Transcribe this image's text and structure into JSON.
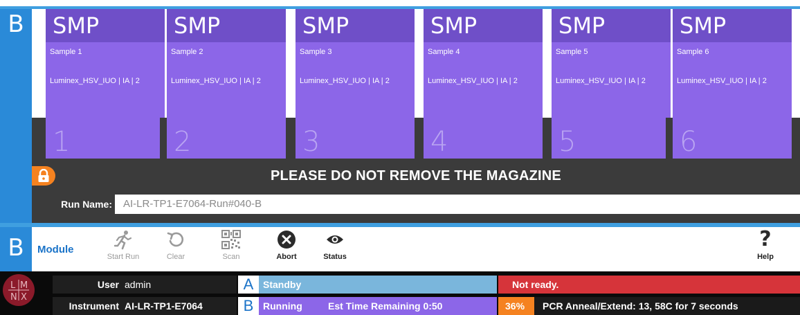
{
  "module": {
    "letter": "B",
    "magazine_message": "PLEASE DO NOT REMOVE THE MAGAZINE",
    "run_name_label": "Run Name:",
    "run_name_value": "AI-LR-TP1-E7064-Run#040-B",
    "samples": [
      {
        "type": "SMP",
        "name": "Sample 1",
        "assay": "Luminex_HSV_IUO | IA | 2",
        "slot": "1"
      },
      {
        "type": "SMP",
        "name": "Sample 2",
        "assay": "Luminex_HSV_IUO | IA | 2",
        "slot": "2"
      },
      {
        "type": "SMP",
        "name": "Sample 3",
        "assay": "Luminex_HSV_IUO | IA | 2",
        "slot": "3"
      },
      {
        "type": "SMP",
        "name": "Sample 4",
        "assay": "Luminex_HSV_IUO | IA | 2",
        "slot": "4"
      },
      {
        "type": "SMP",
        "name": "Sample 5",
        "assay": "Luminex_HSV_IUO | IA | 2",
        "slot": "5"
      },
      {
        "type": "SMP",
        "name": "Sample 6",
        "assay": "Luminex_HSV_IUO | IA | 2",
        "slot": "6"
      }
    ]
  },
  "toolbar": {
    "letter": "B",
    "module_label": "Module",
    "start_run": "Start Run",
    "clear": "Clear",
    "scan": "Scan",
    "abort": "Abort",
    "status": "Status",
    "help": "Help"
  },
  "statusbar": {
    "logo_text": "L|M N|X",
    "user_label": "User",
    "user_value": "admin",
    "instrument_label": "Instrument",
    "instrument_value": "AI-LR-TP1-E7064",
    "module_a": {
      "letter": "A",
      "state": "Standby",
      "message": "Not ready."
    },
    "module_b": {
      "letter": "B",
      "state": "Running",
      "remaining": "Est Time Remaining 0:50",
      "progress_percent": "36%",
      "progress_fraction": 0.36,
      "step": "PCR Anneal/Extend: 13, 58C for 7 seconds"
    }
  },
  "colors": {
    "accent_blue": "#3f9fe0",
    "card_purple": "#8c66e8",
    "card_header": "#6f4fc8",
    "standby_blue": "#7ab6dc",
    "error_red": "#d6343a",
    "progress_orange": "#f58220"
  },
  "icons": {
    "lock": "lock-icon",
    "start_run": "runner-icon",
    "clear": "refresh-icon",
    "scan": "qr-code-icon",
    "abort": "close-circle-icon",
    "status": "eye-icon",
    "help": "question-mark-icon"
  }
}
